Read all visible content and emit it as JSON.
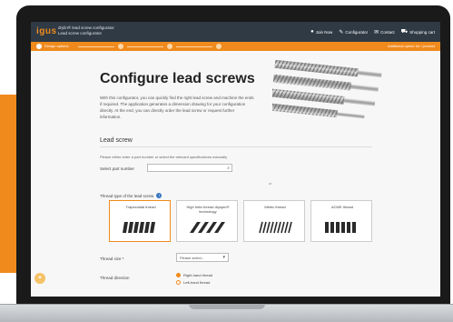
{
  "header": {
    "logo": "igus",
    "app_title": "drylin® lead screw configurator",
    "app_subtitle": "Lead screw configurator",
    "nav": [
      {
        "label": "Join Now",
        "icon": "user-icon"
      },
      {
        "label": "Configurator",
        "icon": "wrench-icon"
      },
      {
        "label": "Contact",
        "icon": "mail-icon"
      },
      {
        "label": "Shopping cart",
        "icon": "cart-icon"
      }
    ]
  },
  "steps": {
    "first": "Design options",
    "right_label": "Additional option for / product"
  },
  "main": {
    "title": "Configure lead screws",
    "intro": "With this configurator, you can quickly find the right lead screw and machine the ends if required. The application generates a dimension drawing for your configuration directly. At the end, you can directly order the lead screw or request further information.",
    "section_title": "Lead screw",
    "hint": "Please either enter a part number or select the relevant specifications manually",
    "part_label": "Select part number",
    "or_label": "or",
    "thread_type_label": "Thread type of the lead screw",
    "thread_cards": [
      {
        "title": "Trapezoidal thread",
        "selected": true
      },
      {
        "title": "High helix thread dryspin® technology",
        "selected": false
      },
      {
        "title": "Metric thread",
        "selected": false
      },
      {
        "title": "ACME thread",
        "selected": false
      }
    ],
    "thread_size_label": "Thread size *",
    "thread_size_value": "Please select...",
    "direction_label": "Thread direction",
    "directions": [
      {
        "label": "Right-hand thread",
        "checked": true
      },
      {
        "label": "Left-hand thread",
        "checked": false
      }
    ]
  },
  "colors": {
    "accent": "#f08a1c",
    "topbar": "#2f3a45"
  }
}
